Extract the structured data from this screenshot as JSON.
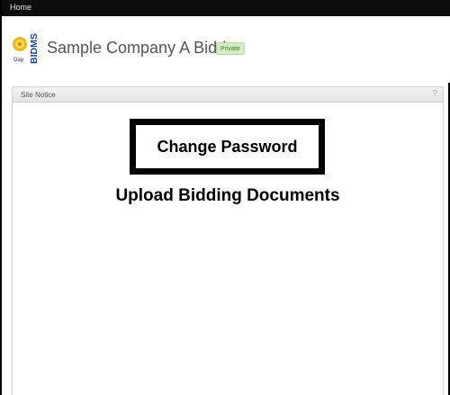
{
  "topbar": {
    "home_label": "Home"
  },
  "header": {
    "logo_text": "BIDMS",
    "logo_small_text": "Dap",
    "company_name": "Sample Company A Bidder",
    "badge": "Private"
  },
  "panel": {
    "title": "Site Notice",
    "help": "?",
    "change_password": "Change Password",
    "upload_documents": "Upload Bidding Documents"
  },
  "colors": {
    "topbar_bg": "#0d0d0d",
    "badge_bg": "#d6ebc8",
    "badge_text": "#3f7a1e",
    "logo_blue": "#1c3f94",
    "logo_gold": "#e8b81c"
  }
}
